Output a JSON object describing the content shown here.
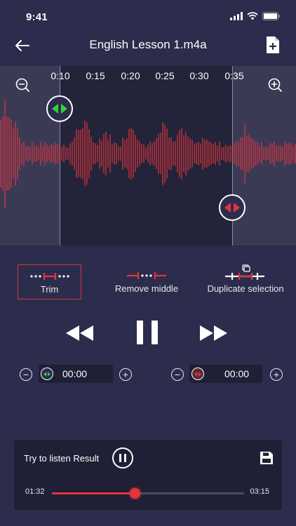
{
  "status": {
    "time": "9:41"
  },
  "header": {
    "title": "English Lesson 1.m4a"
  },
  "timeline": {
    "ticks": [
      "0:10",
      "0:15",
      "0:20",
      "0:25",
      "0:30",
      "0:35"
    ]
  },
  "tools": [
    {
      "label": "Trim",
      "active": true
    },
    {
      "label": "Remove middle",
      "active": false
    },
    {
      "label": "Duplicate selection",
      "active": false
    }
  ],
  "start_time": {
    "value": "00:00"
  },
  "end_time": {
    "value": "00:00"
  },
  "result": {
    "label": "Try to listen Result",
    "current": "01:32",
    "total": "03:15",
    "progress": 0.43
  },
  "colors": {
    "accent": "#e4353c",
    "start_handle": "#2fd33a",
    "background": "#2c2c4c",
    "panel": "#1f1f35"
  }
}
